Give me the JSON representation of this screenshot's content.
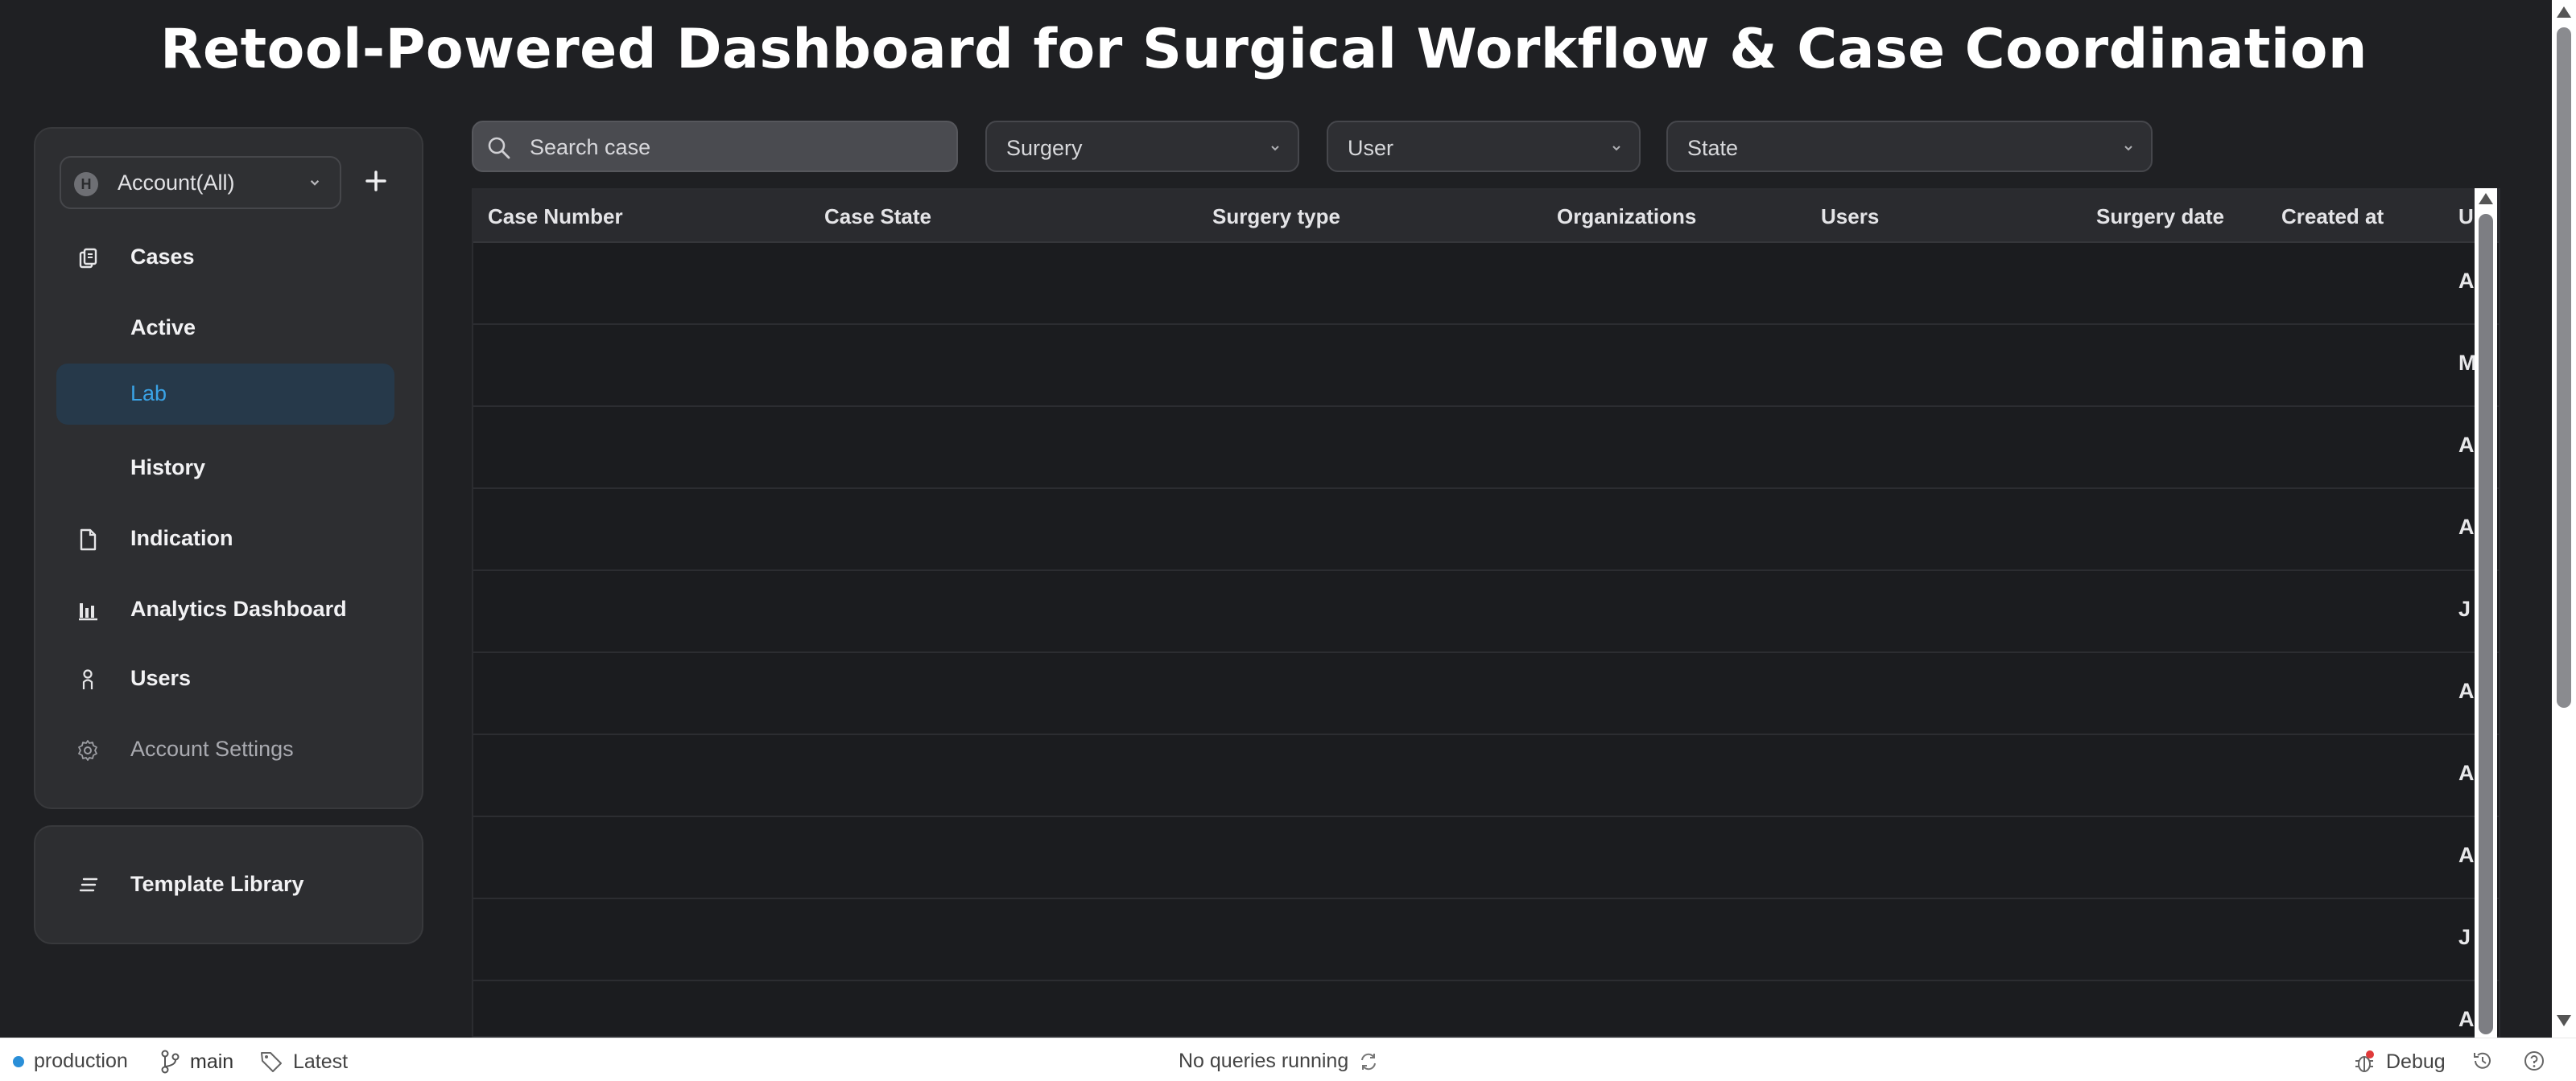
{
  "page_title": "Retool-Powered Dashboard for Surgical Workflow & Case Coordination",
  "sidebar": {
    "account_badge": "H",
    "account_label": "Account(All)",
    "items": [
      {
        "label": "Cases",
        "icon": "cases-icon"
      },
      {
        "label": "Active"
      },
      {
        "label": "Lab"
      },
      {
        "label": "History"
      },
      {
        "label": "Indication",
        "icon": "document-icon"
      },
      {
        "label": "Analytics Dashboard",
        "icon": "bar-chart-icon"
      },
      {
        "label": "Users",
        "icon": "user-icon"
      },
      {
        "label": "Account Settings",
        "icon": "gear-icon"
      }
    ],
    "template_library": "Template Library"
  },
  "toolbar": {
    "search_placeholder": "Search case",
    "surgery_label": "Surgery",
    "user_label": "User",
    "state_label": "State"
  },
  "table": {
    "columns": [
      "Case Number",
      "Case State",
      "Surgery type",
      "Organizations",
      "Users",
      "Surgery date",
      "Created at",
      "U"
    ],
    "rows": [
      {
        "last": "A"
      },
      {
        "last": "M"
      },
      {
        "last": "A"
      },
      {
        "last": "A"
      },
      {
        "last": "J"
      },
      {
        "last": "A"
      },
      {
        "last": "A"
      },
      {
        "last": "A"
      },
      {
        "last": "J"
      },
      {
        "last": "A"
      }
    ]
  },
  "footer": {
    "env": "production",
    "branch": "main",
    "version": "Latest",
    "status": "No queries running",
    "debug": "Debug"
  },
  "colors": {
    "accent": "#3aa3e6",
    "active_bg": "#26394a",
    "env_dot": "#2a8fd8"
  }
}
